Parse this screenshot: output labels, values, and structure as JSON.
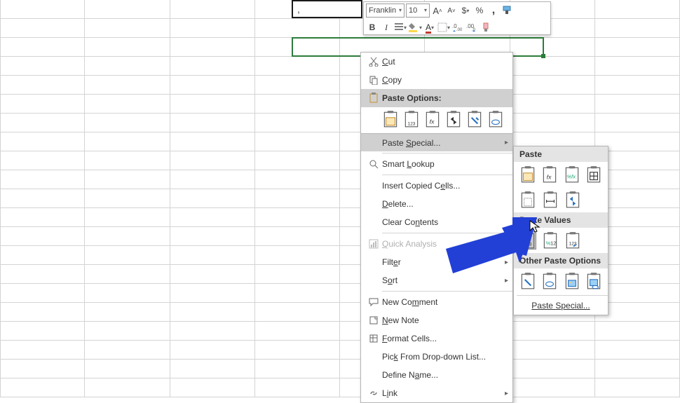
{
  "mini_toolbar": {
    "font_name": "Franklin",
    "font_size": "10",
    "increase_font": "A˄",
    "decrease_font": "A˅",
    "accounting": "$",
    "percent": "%",
    "comma": ",",
    "bold": "B",
    "italic": "I"
  },
  "cell_value": ",",
  "context_menu": {
    "cut": "Cut",
    "copy": "Copy",
    "paste_options": "Paste Options:",
    "paste_special": "Paste Special...",
    "smart_lookup": "Smart Lookup",
    "insert_copied": "Insert Copied Cells...",
    "delete": "Delete...",
    "clear_contents": "Clear Contents",
    "quick_analysis": "Quick Analysis",
    "filter": "Filter",
    "sort": "Sort",
    "new_comment": "New Comment",
    "new_note": "New Note",
    "format_cells": "Format Cells...",
    "pick_list": "Pick From Drop-down List...",
    "define_name": "Define Name...",
    "link": "Link"
  },
  "submenu": {
    "paste_hdr": "Paste",
    "paste_values_hdr": "Paste Values",
    "other_hdr": "Other Paste Options",
    "paste_special": "Paste Special..."
  }
}
